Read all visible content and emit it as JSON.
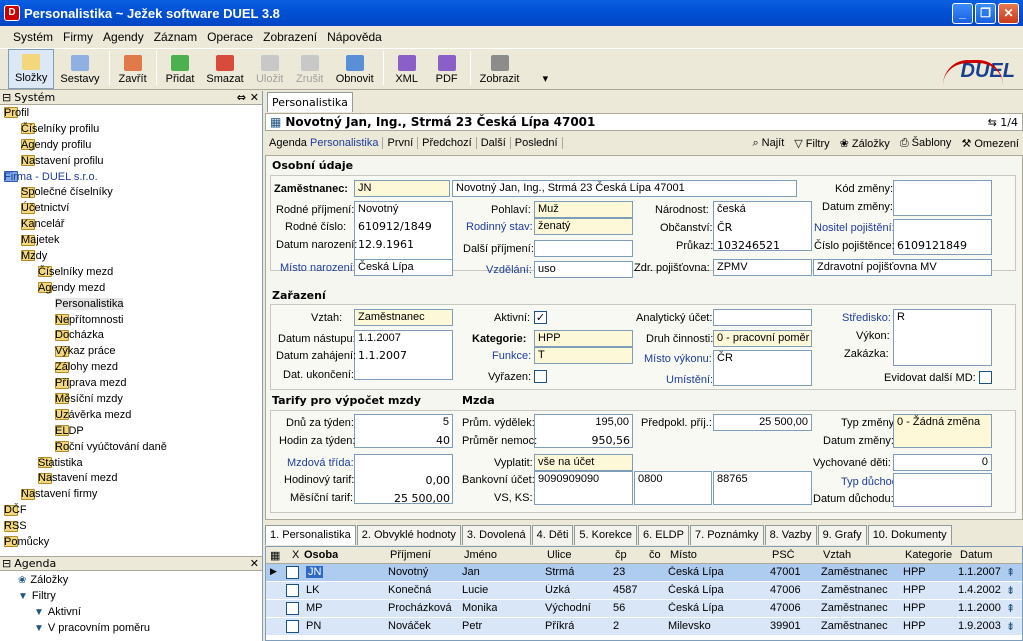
{
  "window": {
    "title": "Personalistika ~ Ježek software DUEL 3.8",
    "app_icon": "D"
  },
  "menu": [
    "Systém",
    "Firmy",
    "Agendy",
    "Záznam",
    "Operace",
    "Zobrazení",
    "Nápověda"
  ],
  "toolbar": [
    {
      "label": "Složky",
      "icon": "folders-icon",
      "state": "active"
    },
    {
      "label": "Sestavy",
      "icon": "reports-icon",
      "state": "normal"
    },
    {
      "label": "Zavřít",
      "icon": "close-doc-icon",
      "state": "normal"
    },
    {
      "label": "Přidat",
      "icon": "add-icon",
      "state": "normal"
    },
    {
      "label": "Smazat",
      "icon": "delete-icon",
      "state": "normal"
    },
    {
      "label": "Uložit",
      "icon": "save-icon",
      "state": "disabled"
    },
    {
      "label": "Zrušit",
      "icon": "cancel-icon",
      "state": "disabled"
    },
    {
      "label": "Obnovit",
      "icon": "refresh-icon",
      "state": "normal"
    },
    {
      "label": "XML",
      "icon": "xml-icon",
      "state": "normal"
    },
    {
      "label": "PDF",
      "icon": "pdf-icon",
      "state": "normal"
    },
    {
      "label": "Zobrazit",
      "icon": "view-icon",
      "state": "normal"
    }
  ],
  "logo": "DUEL",
  "left": {
    "header": "Systém",
    "tree": [
      {
        "label": "Profil",
        "level": 0,
        "pm": "-"
      },
      {
        "label": "Číselníky profilu",
        "level": 1,
        "pm": "+"
      },
      {
        "label": "Agendy profilu",
        "level": 1,
        "pm": "+"
      },
      {
        "label": "Nastavení profilu",
        "level": 1,
        "pm": "+"
      },
      {
        "label": "Firma - DUEL s.r.o.",
        "level": 0,
        "pm": "-",
        "blue": true
      },
      {
        "label": "Společné číselníky",
        "level": 1,
        "pm": "+"
      },
      {
        "label": "Účetnictví",
        "level": 1,
        "pm": "+"
      },
      {
        "label": "Kancelář",
        "level": 1,
        "pm": "+"
      },
      {
        "label": "Majetek",
        "level": 1,
        "pm": "+"
      },
      {
        "label": "Mzdy",
        "level": 1,
        "pm": "-"
      },
      {
        "label": "Číselníky mezd",
        "level": 2,
        "pm": "+"
      },
      {
        "label": "Agendy mezd",
        "level": 2,
        "pm": "-"
      },
      {
        "label": "Personalistika",
        "level": 3,
        "pm": "",
        "sel": true
      },
      {
        "label": "Nepřítomnosti",
        "level": 3,
        "pm": ""
      },
      {
        "label": "Docházka",
        "level": 3,
        "pm": ""
      },
      {
        "label": "Výkaz práce",
        "level": 3,
        "pm": ""
      },
      {
        "label": "Zálohy mezd",
        "level": 3,
        "pm": ""
      },
      {
        "label": "Příprava mezd",
        "level": 3,
        "pm": ""
      },
      {
        "label": "Měsíční mzdy",
        "level": 3,
        "pm": ""
      },
      {
        "label": "Uzávěrka mezd",
        "level": 3,
        "pm": ""
      },
      {
        "label": "ELDP",
        "level": 3,
        "pm": ""
      },
      {
        "label": "Roční vyúčtování daně",
        "level": 3,
        "pm": ""
      },
      {
        "label": "Statistika",
        "level": 2,
        "pm": "+"
      },
      {
        "label": "Nastavení mezd",
        "level": 2,
        "pm": "+"
      },
      {
        "label": "Nastavení firmy",
        "level": 1,
        "pm": "+"
      },
      {
        "label": "DČF",
        "level": 0,
        "pm": "+"
      },
      {
        "label": "RSS",
        "level": 0,
        "pm": "+"
      },
      {
        "label": "Pomůcky",
        "level": 0,
        "pm": "+"
      }
    ],
    "agenda_header": "Agenda",
    "agenda": [
      "Záložky",
      "Filtry",
      "Aktivní",
      "V pracovním poměru"
    ]
  },
  "doc_tab": "Personalistika",
  "record": {
    "title": "Novotný Jan, Ing., Strmá 23 Česká Lípa 47001",
    "page": "1/4"
  },
  "nav": {
    "agenda_prefix": "Agenda",
    "agenda": "Personalistika",
    "buttons": [
      "První",
      "Předchozí",
      "Další",
      "Poslední"
    ],
    "right": [
      "Najít",
      "Filtry",
      "Záložky",
      "Šablony",
      "Omezení"
    ]
  },
  "form": {
    "s1": "Osobní údaje",
    "zam_label": "Zaměstnanec:",
    "zam_code": "JN",
    "zam_name": "Novotný Jan, Ing., Strmá 23 Česká Lípa 47001",
    "rod_prijmeni_l": "Rodné příjmení:",
    "rod_prijmeni": "Novotný",
    "rod_cislo_l": "Rodné číslo:",
    "rod_cislo": "610912/1849",
    "dat_nar_l": "Datum narození:",
    "dat_nar": "12.9.1961",
    "misto_nar_l": "Místo narození:",
    "misto_nar": "Česká Lípa",
    "pohlavi_l": "Pohlaví:",
    "pohlavi": "Muž",
    "stav_l": "Rodinný stav:",
    "stav": "ženatý",
    "dalsi_prijmeni_l": "Další příjmení:",
    "vzdelani_l": "Vzdělání:",
    "vzdelani": "uso",
    "narodnost_l": "Národnost:",
    "narodnost": "česká",
    "obcanstvi_l": "Občanství:",
    "obcanstvi": "ČR",
    "prukaz_l": "Průkaz:",
    "prukaz": "103246521",
    "zdr_l": "Zdr. pojišťovna:",
    "zdr_code": "ZPMV",
    "zdr_name": "Zdravotní pojišťovna MV",
    "kod_zmeny_l": "Kód změny:",
    "dat_zmeny_l": "Datum změny:",
    "nositel_l": "Nositel pojištění:",
    "cislo_poj_l": "Číslo pojištěnce:",
    "cislo_poj": "6109121849",
    "s2": "Zařazení",
    "vztah_l": "Vztah:",
    "vztah": "Zaměstnanec",
    "dat_nast_l": "Datum nástupu:",
    "dat_nast": "1.1.2007",
    "dat_zah_l": "Datum zahájení:",
    "dat_zah": "1.1.2007",
    "dat_uk_l": "Dat. ukončení:",
    "aktivni_l": "Aktivní:",
    "aktivni": "✓",
    "kategorie_l": "Kategorie:",
    "kategorie": "HPP",
    "funkce_l": "Funkce:",
    "funkce": "T",
    "vyrazen_l": "Vyřazen:",
    "anal_l": "Analytický účet:",
    "druh_l": "Druh činnosti:",
    "druh": "0 - pracovní poměr",
    "misto_vyk_l": "Místo výkonu:",
    "misto_vyk": "ČR",
    "umisteni_l": "Umístění:",
    "stredisko_l": "Středisko:",
    "stredisko": "R",
    "vykon_l": "Výkon:",
    "zakazka_l": "Zakázka:",
    "evid_l": "Evidovat další MD:",
    "s3": "Tarify pro výpočet mzdy",
    "s4": "Mzda",
    "dnu_l": "Dnů za týden:",
    "dnu": "5",
    "hodin_l": "Hodin za týden:",
    "hodin": "40",
    "trida_l": "Mzdová třída:",
    "hod_tarif_l": "Hodinový tarif:",
    "hod_tarif": "0,00",
    "mes_tarif_l": "Měsíční tarif:",
    "mes_tarif": "25 500,00",
    "prum_vyd_l": "Prům. výdělek:",
    "prum_vyd": "195,00",
    "prum_nem_l": "Průměr nemoc:",
    "prum_nem": "950,56",
    "vyplatit_l": "Vyplatit:",
    "vyplatit": "vše na účet",
    "bank_l": "Bankovní účet:",
    "bank": "9090909090",
    "bank_code": "0800",
    "bank_ks": "88765",
    "vsks_l": "VS, KS:",
    "predp_l": "Předpokl. příj.:",
    "predp": "25 500,00",
    "typ_zm_l": "Typ změny:",
    "typ_zm": "0 - Žádná změna",
    "dat_zm2_l": "Datum změny:",
    "deti_l": "Vychované děti:",
    "deti": "0",
    "typ_duch_l": "Typ důchodu:",
    "dat_duch_l": "Datum důchodu:"
  },
  "tabs": [
    "1. Personalistika",
    "2. Obvyklé hodnoty",
    "3. Dovolená",
    "4. Děti",
    "5. Korekce",
    "6. ELDP",
    "7. Poznámky",
    "8. Vazby",
    "9. Grafy",
    "10. Dokumenty"
  ],
  "grid": {
    "columns": [
      "X",
      "Osoba",
      "Příjmení",
      "Jméno",
      "Ulice",
      "čp",
      "čo",
      "Místo",
      "PSČ",
      "Vztah",
      "Kategorie",
      "Datum"
    ],
    "rows": [
      [
        "JN",
        "Novotný",
        "Jan",
        "Strmá",
        "23",
        "",
        "Česká Lípa",
        "47001",
        "Zaměstnanec",
        "HPP",
        "1.1.2007"
      ],
      [
        "LK",
        "Konečná",
        "Lucie",
        "Úzká",
        "4587",
        "",
        "Česká Lípa",
        "47006",
        "Zaměstnanec",
        "HPP",
        "1.4.2002"
      ],
      [
        "MP",
        "Procházková",
        "Monika",
        "Východní",
        "56",
        "",
        "Česká Lípa",
        "47006",
        "Zaměstnanec",
        "HPP",
        "1.1.2000"
      ],
      [
        "PN",
        "Nováček",
        "Petr",
        "Příkrá",
        "2",
        "",
        "Milevsko",
        "39901",
        "Zaměstnanec",
        "HPP",
        "1.9.2003"
      ]
    ]
  },
  "colors": {
    "titlebar": "#0251d6",
    "selection": "#aecbf0",
    "row": "#d9e6f7",
    "accent_label": "#1e3d9b"
  }
}
